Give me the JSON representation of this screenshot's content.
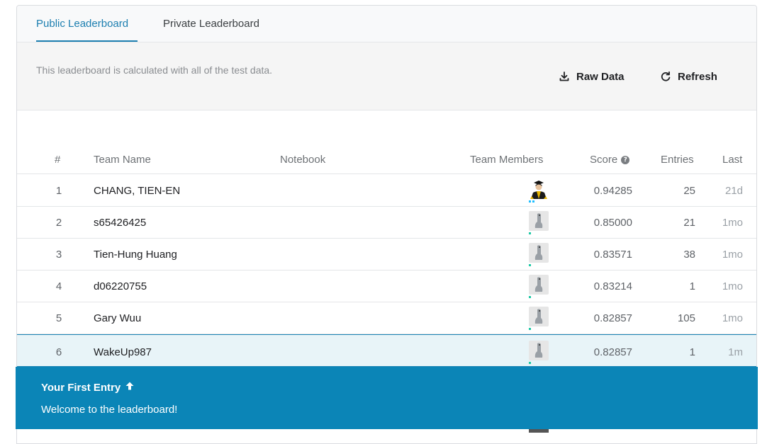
{
  "tabs": [
    {
      "label": "Public Leaderboard",
      "active": true
    },
    {
      "label": "Private Leaderboard",
      "active": false
    }
  ],
  "info": {
    "text": "This leaderboard is calculated with all of the test data.",
    "raw_data_label": "Raw Data",
    "refresh_label": "Refresh"
  },
  "table": {
    "headers": {
      "rank": "#",
      "team": "Team Name",
      "notebook": "Notebook",
      "members": "Team Members",
      "score": "Score",
      "entries": "Entries",
      "last": "Last"
    },
    "rows": [
      {
        "rank": "1",
        "team": "CHANG, TIEN-EN",
        "avatar": "graduate-avatar",
        "score": "0.94285",
        "entries": "25",
        "last": "21d"
      },
      {
        "rank": "2",
        "team": "s65426425",
        "avatar": "default-avatar",
        "score": "0.85000",
        "entries": "21",
        "last": "1mo"
      },
      {
        "rank": "3",
        "team": "Tien-Hung Huang",
        "avatar": "default-avatar",
        "score": "0.83571",
        "entries": "38",
        "last": "1mo"
      },
      {
        "rank": "4",
        "team": "d06220755",
        "avatar": "default-avatar",
        "score": "0.83214",
        "entries": "1",
        "last": "1mo"
      },
      {
        "rank": "5",
        "team": "Gary Wuu",
        "avatar": "default-avatar",
        "score": "0.82857",
        "entries": "105",
        "last": "1mo"
      },
      {
        "rank": "6",
        "team": "WakeUp987",
        "avatar": "default-avatar",
        "score": "0.82857",
        "entries": "1",
        "last": "1m"
      }
    ]
  },
  "toast": {
    "title": "Your First Entry",
    "message": "Welcome to the leaderboard!"
  },
  "colors": {
    "accent": "#1d7fb0",
    "toast_bg": "#0b85b7",
    "highlight_bg": "#e8f4f8"
  }
}
